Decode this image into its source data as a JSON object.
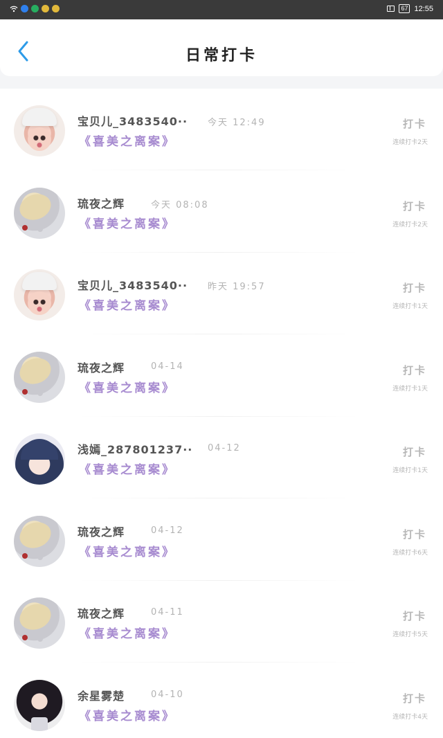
{
  "status_bar": {
    "icons": [
      "wifi-icon",
      "app-icon-blue",
      "app-icon-green",
      "app-icon-yellow",
      "app-icon-yellow"
    ],
    "icon_colors": [
      "#2f80ed",
      "#27ae60",
      "#e2b93b",
      "#e2b93b"
    ],
    "battery": "67",
    "time": "12:55"
  },
  "header": {
    "title": "日常打卡",
    "back_icon": "chevron-left-icon",
    "accent_color": "#2d9be8"
  },
  "list": {
    "action_label": "打卡",
    "book_color": "#a78bd0",
    "items": [
      {
        "avatar": "girl",
        "name": "宝贝儿_3483540··",
        "time": "今天 12:49",
        "book": "《喜美之离案》",
        "streak": "连续打卡2天"
      },
      {
        "avatar": "blonde",
        "name": "琉夜之辉",
        "time": "今天 08:08",
        "book": "《喜美之离案》",
        "streak": "连续打卡2天"
      },
      {
        "avatar": "girl",
        "name": "宝贝儿_3483540··",
        "time": "昨天 19:57",
        "book": "《喜美之离案》",
        "streak": "连续打卡1天"
      },
      {
        "avatar": "blonde",
        "name": "琉夜之辉",
        "time": "04-14",
        "book": "《喜美之离案》",
        "streak": "连续打卡1天"
      },
      {
        "avatar": "anime",
        "name": "浅嫣_287801237··",
        "time": "04-12",
        "book": "《喜美之离案》",
        "streak": "连续打卡1天"
      },
      {
        "avatar": "blonde",
        "name": "琉夜之辉",
        "time": "04-12",
        "book": "《喜美之离案》",
        "streak": "连续打卡6天"
      },
      {
        "avatar": "blonde",
        "name": "琉夜之辉",
        "time": "04-11",
        "book": "《喜美之离案》",
        "streak": "连续打卡5天"
      },
      {
        "avatar": "dark",
        "name": "余星雾楚",
        "time": "04-10",
        "book": "《喜美之离案》",
        "streak": "连续打卡4天"
      }
    ]
  }
}
